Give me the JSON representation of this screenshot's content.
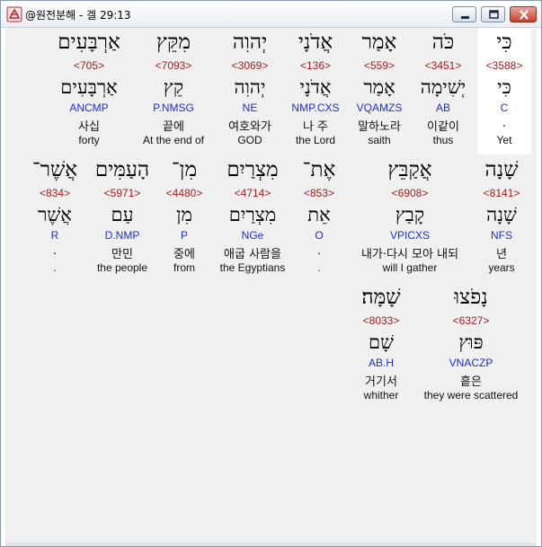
{
  "window": {
    "title": "@원전분해 - 겔 29:13"
  },
  "rows": [
    {
      "cells": [
        {
          "heb": "כִּי",
          "strong": "<3588>",
          "heb2": "כִּי",
          "morph": "C",
          "kor": ".",
          "eng": "Yet",
          "highlight": true
        },
        {
          "heb": "כֹּה",
          "strong": "<3451>",
          "heb2": "יְשִׁימָה",
          "morph": "AB",
          "kor": "이같이",
          "eng": "thus"
        },
        {
          "heb": "אָמַר",
          "strong": "<559>",
          "heb2": "אָמַר",
          "morph": "VQAMZS",
          "kor": "말하노라",
          "eng": "saith"
        },
        {
          "heb": "אֲדֹנָי",
          "strong": "<136>",
          "heb2": "אֲדֹנָי",
          "morph": "NMP.CXS",
          "kor": "나 주",
          "eng": "the Lord"
        },
        {
          "heb": "יְהוִה",
          "strong": "<3069>",
          "heb2": "יְהוִה",
          "morph": "NE",
          "kor": "여호와가",
          "eng": "GOD"
        },
        {
          "heb": "מִקֵּץ",
          "strong": "<7093>",
          "heb2": "קֵץ",
          "morph": "P.NMSG",
          "kor": "끝에",
          "eng": "At the end of"
        },
        {
          "heb": "אַרְבָּעִים",
          "strong": "<705>",
          "heb2": "אַרְבָּעִים",
          "morph": "ANCMP",
          "kor": "사십",
          "eng": "forty"
        }
      ]
    },
    {
      "cells": [
        {
          "heb": "שָׁנָה",
          "strong": "<8141>",
          "heb2": "שָׁנָה",
          "morph": "NFS",
          "kor": "년",
          "eng": "years"
        },
        {
          "heb": "אֲקַבֵּץ",
          "strong": "<6908>",
          "heb2": "קָבַץ",
          "morph": "VPICXS",
          "kor": "내가·다시 모아 내되",
          "eng": "will I gather"
        },
        {
          "heb": "אֶת־",
          "strong": "<853>",
          "heb2": "אֵת",
          "morph": "O",
          "kor": ".",
          "eng": "."
        },
        {
          "heb": "מִצְרַיִם",
          "strong": "<4714>",
          "heb2": "מִצְרַיִם",
          "morph": "NGe",
          "kor": "애굽 사람을",
          "eng": "the Egyptians"
        },
        {
          "heb": "מִן־",
          "strong": "<4480>",
          "heb2": "מִן",
          "morph": "P",
          "kor": "중에",
          "eng": "from"
        },
        {
          "heb": "הָעַמִּים",
          "strong": "<5971>",
          "heb2": "עַם",
          "morph": "D.NMP",
          "kor": "만민",
          "eng": "the people"
        },
        {
          "heb": "אֲשֶׁר־",
          "strong": "<834>",
          "heb2": "אֲשֶׁר",
          "morph": "R",
          "kor": ".",
          "eng": "."
        }
      ]
    },
    {
      "cells": [
        {
          "heb": "נָפֹצוּ",
          "strong": "<6327>",
          "heb2": "פּוּץ",
          "morph": "VNACZP",
          "kor": "흩은",
          "eng": "they were scattered"
        },
        {
          "heb": "שָׁמָּה׃",
          "strong": "<8033>",
          "heb2": "שָׁם",
          "morph": "AB.H",
          "kor": "거기서",
          "eng": "whither"
        }
      ]
    }
  ]
}
